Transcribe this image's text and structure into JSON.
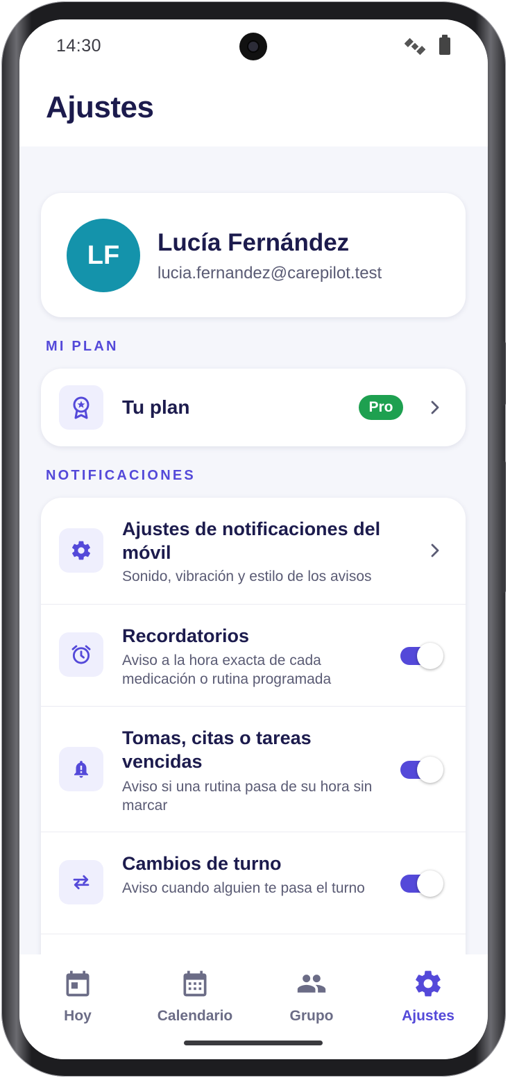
{
  "status_bar": {
    "time": "14:30",
    "icons": [
      "satellite-icon",
      "battery-icon"
    ]
  },
  "header": {
    "title": "Ajustes"
  },
  "profile": {
    "initials": "LF",
    "name": "Lucía Fernández",
    "email": "lucia.fernandez@carepilot.test",
    "avatar_color": "#1493ab"
  },
  "sections": {
    "plan": "MI PLAN",
    "notifications": "NOTIFICACIONES"
  },
  "plan": {
    "label": "Tu plan",
    "badge": "Pro",
    "icon": "award-icon"
  },
  "notifications": {
    "items": [
      {
        "title": "Ajustes de notificaciones del móvil",
        "subtitle": "Sonido, vibración y estilo de los avisos",
        "icon": "gear-icon",
        "control": "chevron"
      },
      {
        "title": "Recordatorios",
        "subtitle": "Aviso a la hora exacta de cada medicación o rutina programada",
        "icon": "alarm-icon",
        "control": "toggle",
        "enabled": true
      },
      {
        "title": "Tomas, citas o tareas vencidas",
        "subtitle": "Aviso si una rutina pasa de su hora sin marcar",
        "icon": "bell-alert-icon",
        "control": "toggle",
        "enabled": true
      },
      {
        "title": "Cambios de turno",
        "subtitle": "Aviso cuando alguien te pasa el turno",
        "icon": "swap-icon",
        "control": "toggle",
        "enabled": true
      }
    ]
  },
  "bottom_nav": {
    "items": [
      {
        "label": "Hoy",
        "icon": "today-calendar-icon"
      },
      {
        "label": "Calendario",
        "icon": "calendar-icon"
      },
      {
        "label": "Grupo",
        "icon": "group-icon"
      },
      {
        "label": "Ajustes",
        "icon": "gear-icon",
        "active": true
      }
    ]
  },
  "colors": {
    "accent": "#5449d9",
    "title": "#1c1b4d",
    "pro_badge": "#1ea050",
    "background": "#f5f6fb"
  }
}
